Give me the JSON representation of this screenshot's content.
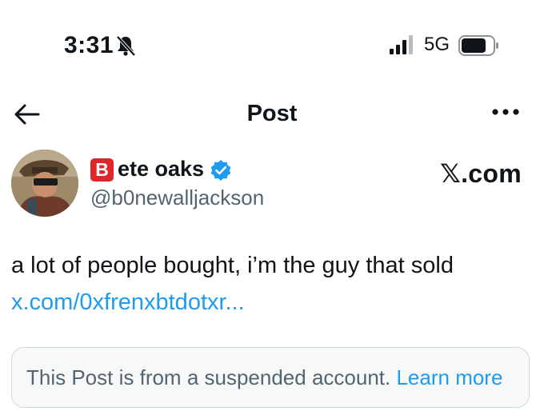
{
  "status_bar": {
    "time": "3:31",
    "network": "5G"
  },
  "nav": {
    "title": "Post"
  },
  "author": {
    "letter_badge": "B",
    "display_name": "ete oaks",
    "handle": "@b0newalljackson"
  },
  "source_label": "𝕏.com",
  "post": {
    "text": "a lot of people bought, i’m the guy that sold",
    "link": "x.com/0xfrenxbtdotxr..."
  },
  "notice": {
    "text": "This Post is from a suspended account.",
    "link_label": "Learn more"
  },
  "colors": {
    "accent": "#1d9bf0",
    "secondary_text": "#536471",
    "badge_red": "#e0262b"
  }
}
